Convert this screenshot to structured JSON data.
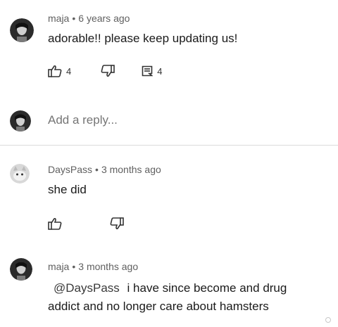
{
  "comments": [
    {
      "author": "maja",
      "time": "6 years ago",
      "text": "adorable!! please keep updating us!",
      "likes": "4",
      "replies": "4"
    },
    {
      "author": "DaysPass",
      "time": "3 months ago",
      "text": "she did"
    },
    {
      "author": "maja",
      "time": "3 months ago",
      "mention": "@DaysPass",
      "text": "i have since become and drug",
      "text_line2": "addict and no longer care about hamsters"
    }
  ],
  "reply_box": {
    "placeholder": "Add a reply..."
  },
  "separator": "•",
  "icons": {
    "like": "thumbs-up-icon",
    "dislike": "thumbs-down-icon",
    "reply": "reply-comment-icon"
  }
}
